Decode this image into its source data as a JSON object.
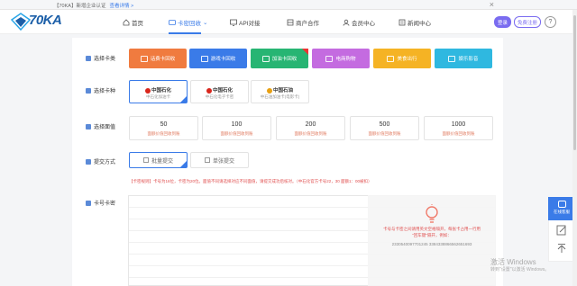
{
  "notice": {
    "text": "【70KA】新增企业认证",
    "link": "查看详情 >",
    "close": "×"
  },
  "header": {
    "logo_text": "70KA",
    "nav": [
      {
        "label": "首页",
        "icon": "home-icon"
      },
      {
        "label": "卡密回收",
        "icon": "card-icon",
        "dropdown": "⌄"
      },
      {
        "label": "API对接",
        "icon": "monitor-icon"
      },
      {
        "label": "商户合作",
        "icon": "merchant-icon"
      },
      {
        "label": "会员中心",
        "icon": "user-icon"
      },
      {
        "label": "新闻中心",
        "icon": "news-icon"
      }
    ],
    "login": "登录",
    "register": "免费注册",
    "help": "?"
  },
  "labels": {
    "card_type": "选择卡类",
    "card_kind": "选择卡种",
    "face_value": "选择面值",
    "submit_method": "提交方式",
    "card_password": "卡号卡密"
  },
  "card_types": [
    {
      "label": "话费卡回收",
      "color": "#f07b3f"
    },
    {
      "label": "游戏卡回收",
      "color": "#3a7be8"
    },
    {
      "label": "加油卡回收",
      "color": "#27b573"
    },
    {
      "label": "电商购物",
      "color": "#c46be0"
    },
    {
      "label": "美食出行",
      "color": "#f5b324"
    },
    {
      "label": "娱乐影音",
      "color": "#2fb8e0"
    }
  ],
  "brands": [
    {
      "name": "中国石化",
      "sub": "中石化加油卡",
      "color": "#d9261c"
    },
    {
      "name": "中国石化",
      "sub": "中石化电子卡密",
      "color": "#d9261c"
    },
    {
      "name": "中国石油",
      "sub": "中石油加油卡(电影卡)",
      "color": "#e8a012"
    }
  ],
  "amounts": [
    {
      "value": "50",
      "note": "面额价值回收到账"
    },
    {
      "value": "100",
      "note": "面额价值回收到账"
    },
    {
      "value": "200",
      "note": "面额价值回收到账"
    },
    {
      "value": "500",
      "note": "面额价值回收到账"
    },
    {
      "value": "1000",
      "note": "面额价值回收到账"
    }
  ],
  "methods": [
    {
      "label": "批量提交"
    },
    {
      "label": "单张提交"
    }
  ],
  "hint": "【卡密规则】卡号为16位，卡密为20位。面值不同请选择对应不同面值，请提交成功后核对。（中石化官方卡号22，30 面额1：00被扣）",
  "textarea": {
    "placeholder_line1": "卡号与卡密之间请用英文空格隔开，每张卡占用一行用",
    "placeholder_line2": "\"回车键\"隔开，例如：",
    "example": "2330540097701245 3384338866562651693"
  },
  "watermark": {
    "line1": "激活 Windows",
    "line2": "转到\"设置\"以激活 Windows。"
  },
  "float": {
    "service": "在线客服"
  }
}
